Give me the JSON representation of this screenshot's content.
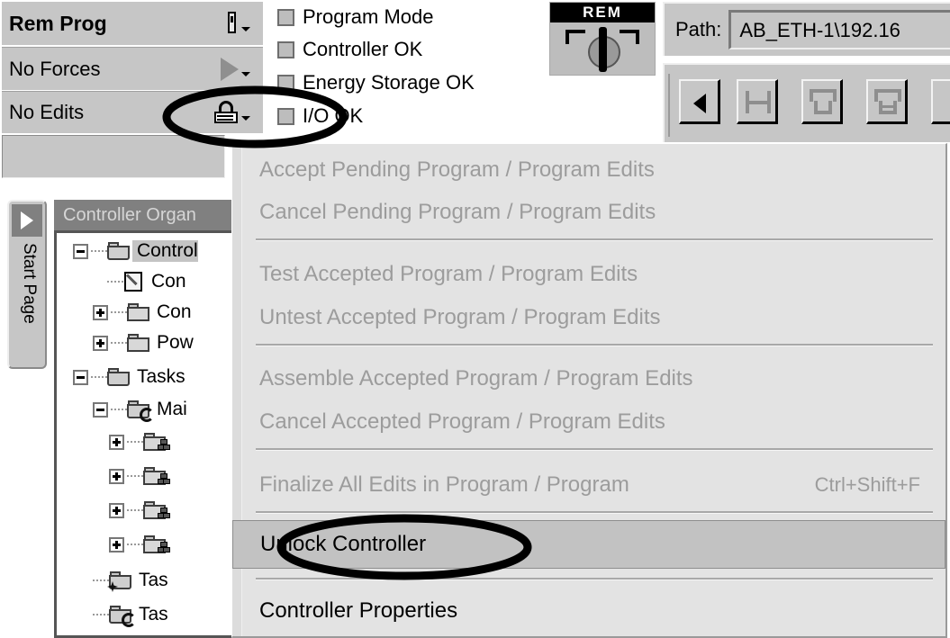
{
  "status_panel": {
    "rows": [
      {
        "label": "Rem Prog",
        "icon": "key-icon",
        "bold": true,
        "has_caret": true
      },
      {
        "label": "No Forces",
        "icon": "force-triangle-icon",
        "bold": false,
        "has_caret": true
      },
      {
        "label": "No Edits",
        "icon": "padlock-icon",
        "bold": false,
        "has_caret": true
      }
    ]
  },
  "checkboxes": [
    {
      "label": "Program Mode",
      "checked": true
    },
    {
      "label": "Controller OK",
      "checked": true
    },
    {
      "label": "Energy Storage OK",
      "checked": true
    },
    {
      "label": "I/O OK",
      "checked": true
    }
  ],
  "keyswitch": {
    "mode_label": "REM",
    "icon": "keyswitch-icon"
  },
  "path": {
    "label": "Path:",
    "value": "AB_ETH-1\\192.16",
    "placeholder": "<none>"
  },
  "toolbar": {
    "buttons": [
      {
        "icon": "back-arrow-icon",
        "name": "nav-back-button"
      },
      {
        "icon": "rung-icon",
        "name": "insert-rung-button"
      },
      {
        "icon": "branch-icon",
        "name": "insert-branch-button"
      },
      {
        "icon": "branch-level-icon",
        "name": "insert-branch-level-button"
      }
    ]
  },
  "start_page_tab": {
    "label": "Start Page",
    "icon": "right-arrow-icon"
  },
  "organizer": {
    "title": "Controller Organ",
    "tree": [
      {
        "label": "Control",
        "icon": "folder-open-icon",
        "expander": "minus",
        "indent": 0,
        "selected": true
      },
      {
        "label": "Con",
        "icon": "controller-tags-icon",
        "expander": "none",
        "indent": 1,
        "selected": false
      },
      {
        "label": "Con",
        "icon": "folder-closed-icon",
        "expander": "plus",
        "indent": 1,
        "selected": false
      },
      {
        "label": "Pow",
        "icon": "folder-closed-icon",
        "expander": "plus",
        "indent": 1,
        "selected": false
      },
      {
        "label": "Tasks",
        "icon": "folder-open-icon",
        "expander": "minus",
        "indent": 0,
        "selected": false
      },
      {
        "label": "Mai",
        "icon": "task-icon",
        "expander": "minus",
        "indent": 1,
        "selected": false
      },
      {
        "label": "",
        "icon": "program-icon",
        "expander": "plus",
        "indent": 2,
        "selected": false
      },
      {
        "label": "",
        "icon": "program-icon",
        "expander": "plus",
        "indent": 2,
        "selected": false
      },
      {
        "label": "",
        "icon": "program-icon",
        "expander": "plus",
        "indent": 2,
        "selected": false
      },
      {
        "label": "",
        "icon": "program-icon",
        "expander": "plus",
        "indent": 2,
        "selected": false
      },
      {
        "label": "Tas",
        "icon": "unscheduled-programs-icon",
        "expander": "none",
        "indent": 2,
        "selected": false
      },
      {
        "label": "Tas",
        "icon": "task-icon",
        "expander": "none",
        "indent": 2,
        "selected": false
      }
    ]
  },
  "context_menu": {
    "items": [
      {
        "text": "Accept Pending Program / Program Edits",
        "mnemonic": "o",
        "mnemonic_word_index": 15,
        "accel": "",
        "state": "disabled",
        "type": "item"
      },
      {
        "text": "Cancel Pending Program / Program Edits",
        "mnemonic": "i",
        "accel": "",
        "state": "disabled",
        "type": "item"
      },
      {
        "type": "separator"
      },
      {
        "text": "Test Accepted Program / Program Edits",
        "mnemonic": "T",
        "accel": "",
        "state": "disabled",
        "type": "item"
      },
      {
        "text": "Untest Accepted Program / Program Edits",
        "mnemonic": "U",
        "accel": "",
        "state": "disabled",
        "type": "item"
      },
      {
        "type": "separator"
      },
      {
        "text": "Assemble Accepted Program / Program Edits",
        "mnemonic": "A",
        "accel": "",
        "state": "disabled",
        "type": "item"
      },
      {
        "text": "Cancel Accepted Program / Program Edits",
        "mnemonic": "C",
        "accel": "",
        "state": "disabled",
        "type": "item"
      },
      {
        "type": "separator"
      },
      {
        "text": "Finalize All Edits in Program / Program",
        "mnemonic": "F",
        "accel": "Ctrl+Shift+F",
        "state": "disabled",
        "type": "item"
      },
      {
        "type": "separator"
      },
      {
        "text": "Unlock Controller",
        "mnemonic": "l",
        "accel": "",
        "state": "highlighted",
        "type": "item"
      },
      {
        "type": "separator"
      },
      {
        "text": "Controller Properties",
        "mnemonic": "n",
        "accel": "",
        "state": "enabled",
        "type": "item"
      }
    ]
  },
  "annotations": [
    {
      "name": "padlock-highlight-ellipse",
      "target": "No Edits padlock"
    },
    {
      "name": "unlock-controller-highlight-ellipse",
      "target": "Unlock Controller"
    }
  ],
  "colors": {
    "chrome": "#c6c6c6",
    "menu_bg": "#e3e3e3",
    "menu_highlight": "#c2c2c2",
    "disabled_text": "#9c9c9c",
    "title_bar": "#808080",
    "annotation": "#000000"
  }
}
